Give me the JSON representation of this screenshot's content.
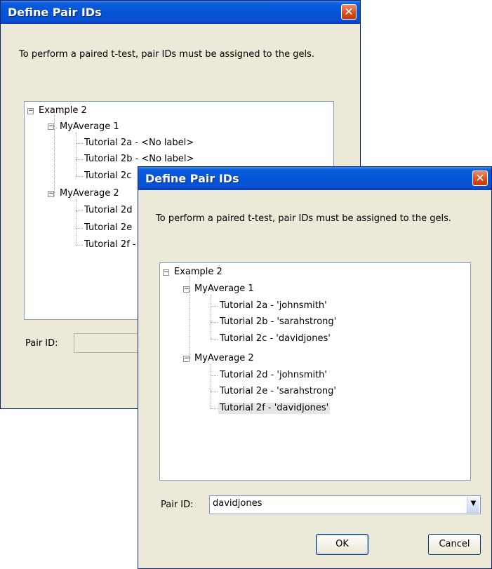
{
  "back_dialog": {
    "title": "Define Pair IDs",
    "close_glyph": "✕",
    "message": "To perform a paired t-test, pair IDs must be assigned to the gels.",
    "tree": {
      "root": "Example 2",
      "group1": "MyAverage 1",
      "g1_items": [
        "Tutorial 2a - <No label>",
        "Tutorial 2b - <No label>",
        "Tutorial 2c"
      ],
      "group2": "MyAverage 2",
      "g2_items": [
        "Tutorial 2d",
        "Tutorial 2e",
        "Tutorial 2f -"
      ]
    },
    "pair_id_label": "Pair ID:"
  },
  "front_dialog": {
    "title": "Define Pair IDs",
    "close_glyph": "✕",
    "message": "To perform a paired t-test, pair IDs must be assigned to the gels.",
    "tree": {
      "root": "Example 2",
      "group1": "MyAverage 1",
      "g1_items": [
        "Tutorial 2a - 'johnsmith'",
        "Tutorial 2b - 'sarahstrong'",
        "Tutorial 2c - 'davidjones'"
      ],
      "group2": "MyAverage 2",
      "g2_items": [
        "Tutorial 2d - 'johnsmith'",
        "Tutorial 2e - 'sarahstrong'",
        "Tutorial 2f - 'davidjones'"
      ],
      "selected": "Tutorial 2f - 'davidjones'"
    },
    "pair_id_label": "Pair ID:",
    "pair_id_value": "davidjones",
    "dropdown_glyph": "▼",
    "ok_label": "OK",
    "cancel_label": "Cancel"
  },
  "colors": {
    "titlebar": "#0654d6",
    "dialog_bg": "#ece9d8",
    "close_button": "#d64b1d",
    "selection": "#e6e6e6"
  },
  "icons": [
    "minus-expander-icon",
    "close-icon",
    "dropdown-arrow-icon"
  ]
}
